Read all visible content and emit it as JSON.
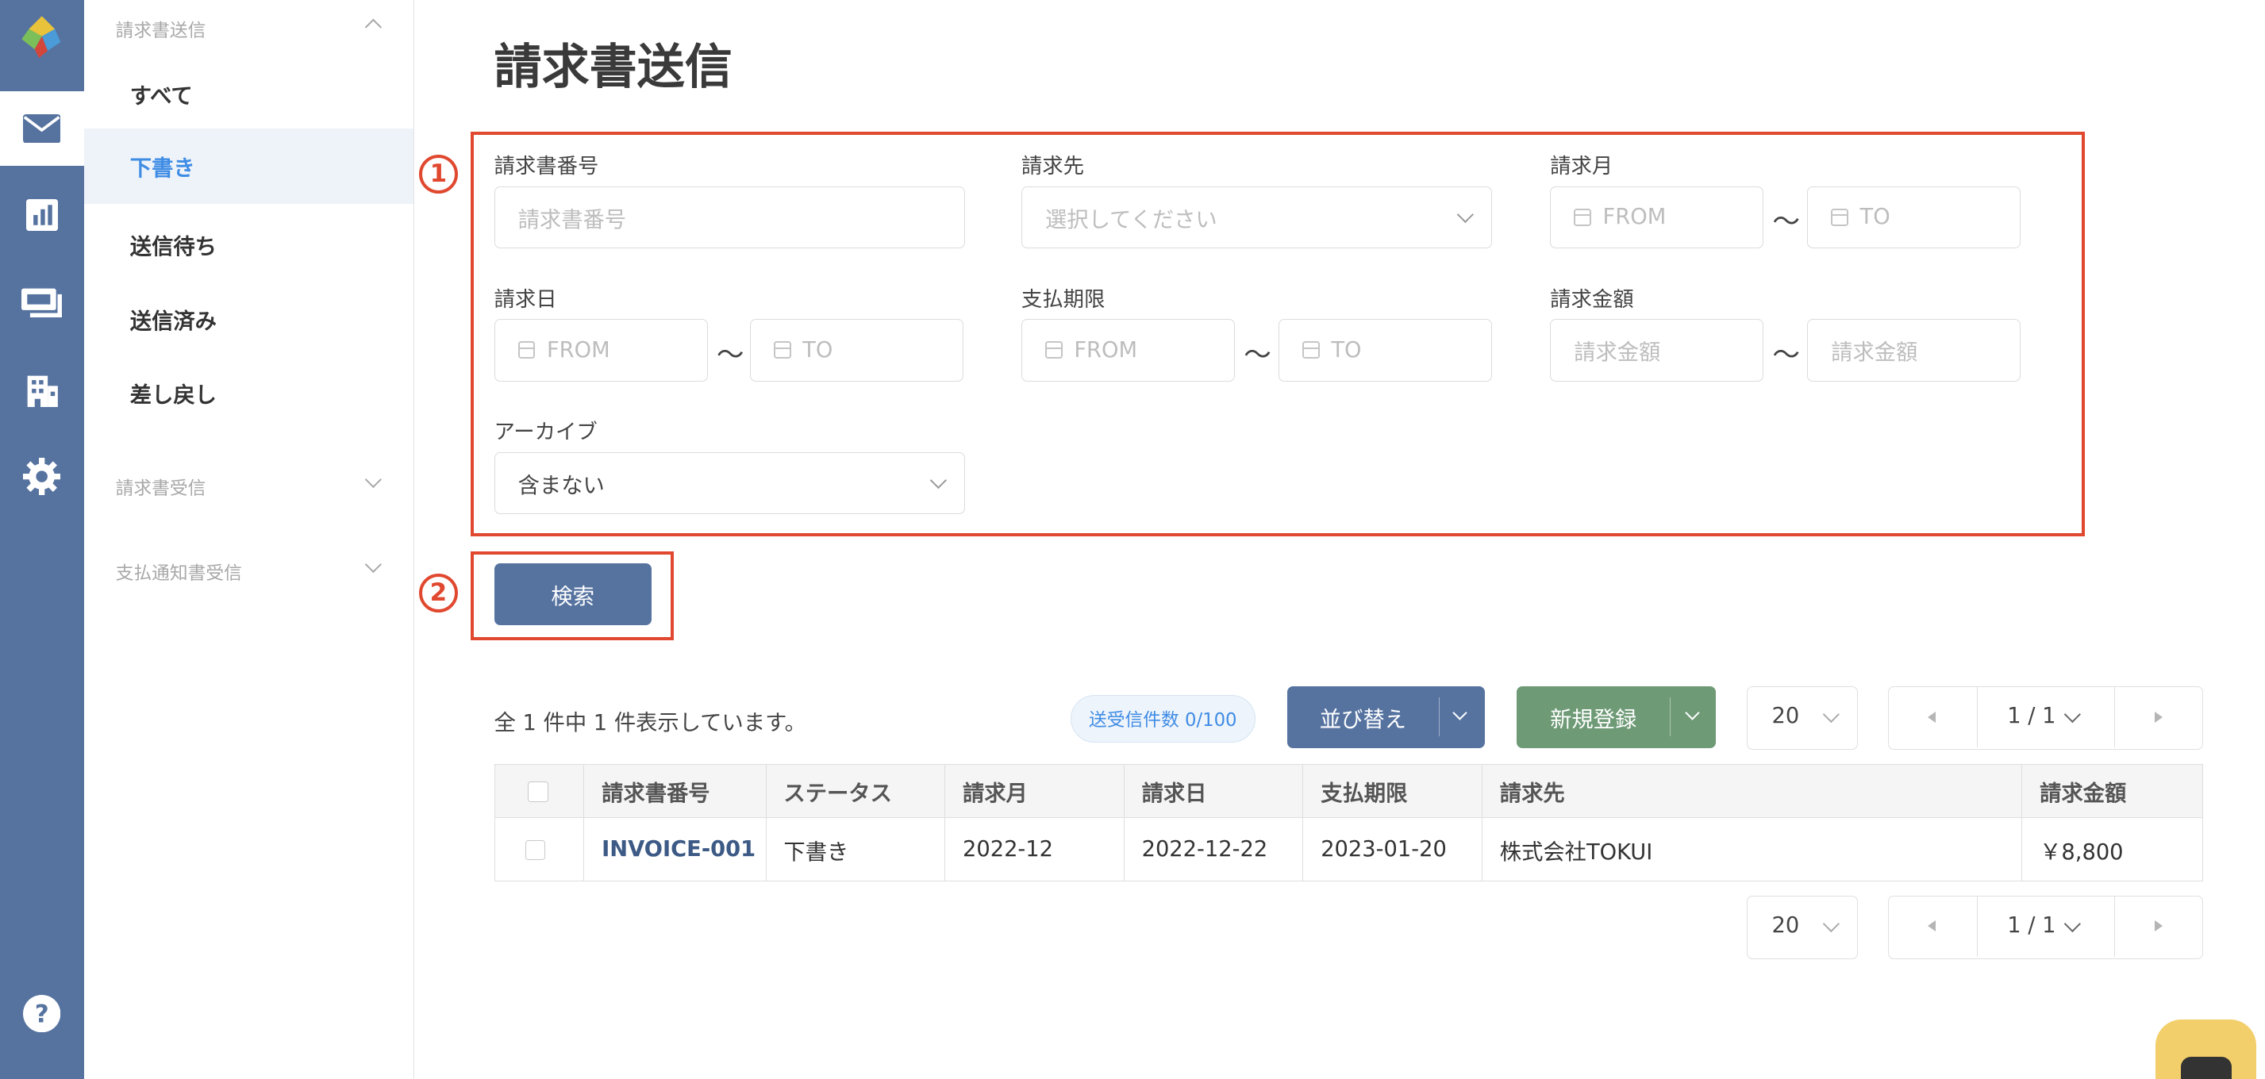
{
  "sidebar": {
    "section_send": "請求書送信",
    "items": [
      {
        "label": "すべて"
      },
      {
        "label": "下書き"
      },
      {
        "label": "送信待ち"
      },
      {
        "label": "送信済み"
      },
      {
        "label": "差し戻し"
      }
    ],
    "section_receive": "請求書受信",
    "section_payment": "支払通知書受信"
  },
  "page": {
    "title": "請求書送信"
  },
  "filters": {
    "invoice_no_label": "請求書番号",
    "invoice_no_placeholder": "請求書番号",
    "client_label": "請求先",
    "client_placeholder": "選択してください",
    "month_label": "請求月",
    "date_label": "請求日",
    "due_label": "支払期限",
    "amount_label": "請求金額",
    "amount_placeholder": "請求金額",
    "from": "FROM",
    "to": "TO",
    "tilde": "〜",
    "archive_label": "アーカイブ",
    "archive_value": "含まない"
  },
  "annotations": {
    "one": "1",
    "two": "2"
  },
  "search_button": "検索",
  "results": {
    "summary": "全 1 件中 1 件表示しています。",
    "count_badge": "送受信件数 0/100",
    "sort_button": "並び替え",
    "new_button": "新規登録",
    "page_size": "20",
    "page_indicator": "1 / 1"
  },
  "table": {
    "headers": [
      "請求書番号",
      "ステータス",
      "請求月",
      "請求日",
      "支払期限",
      "請求先",
      "請求金額"
    ],
    "rows": [
      {
        "invoice_no": "INVOICE-001",
        "status": "下書き",
        "month": "2022-12",
        "date": "2022-12-22",
        "due": "2023-01-20",
        "client": "株式会社TOKUI",
        "amount": "￥8,800"
      }
    ]
  },
  "colors": {
    "rail": "#5673a0",
    "primary_button": "#5673a0",
    "new_button": "#6e9a76",
    "active_link": "#3f8ce5",
    "annotation_red": "#e0482f"
  },
  "icons": {
    "rail": [
      "logo-icon",
      "mail-icon",
      "chart-icon",
      "payment-icon",
      "building-icon",
      "gear-icon",
      "help-icon"
    ]
  }
}
